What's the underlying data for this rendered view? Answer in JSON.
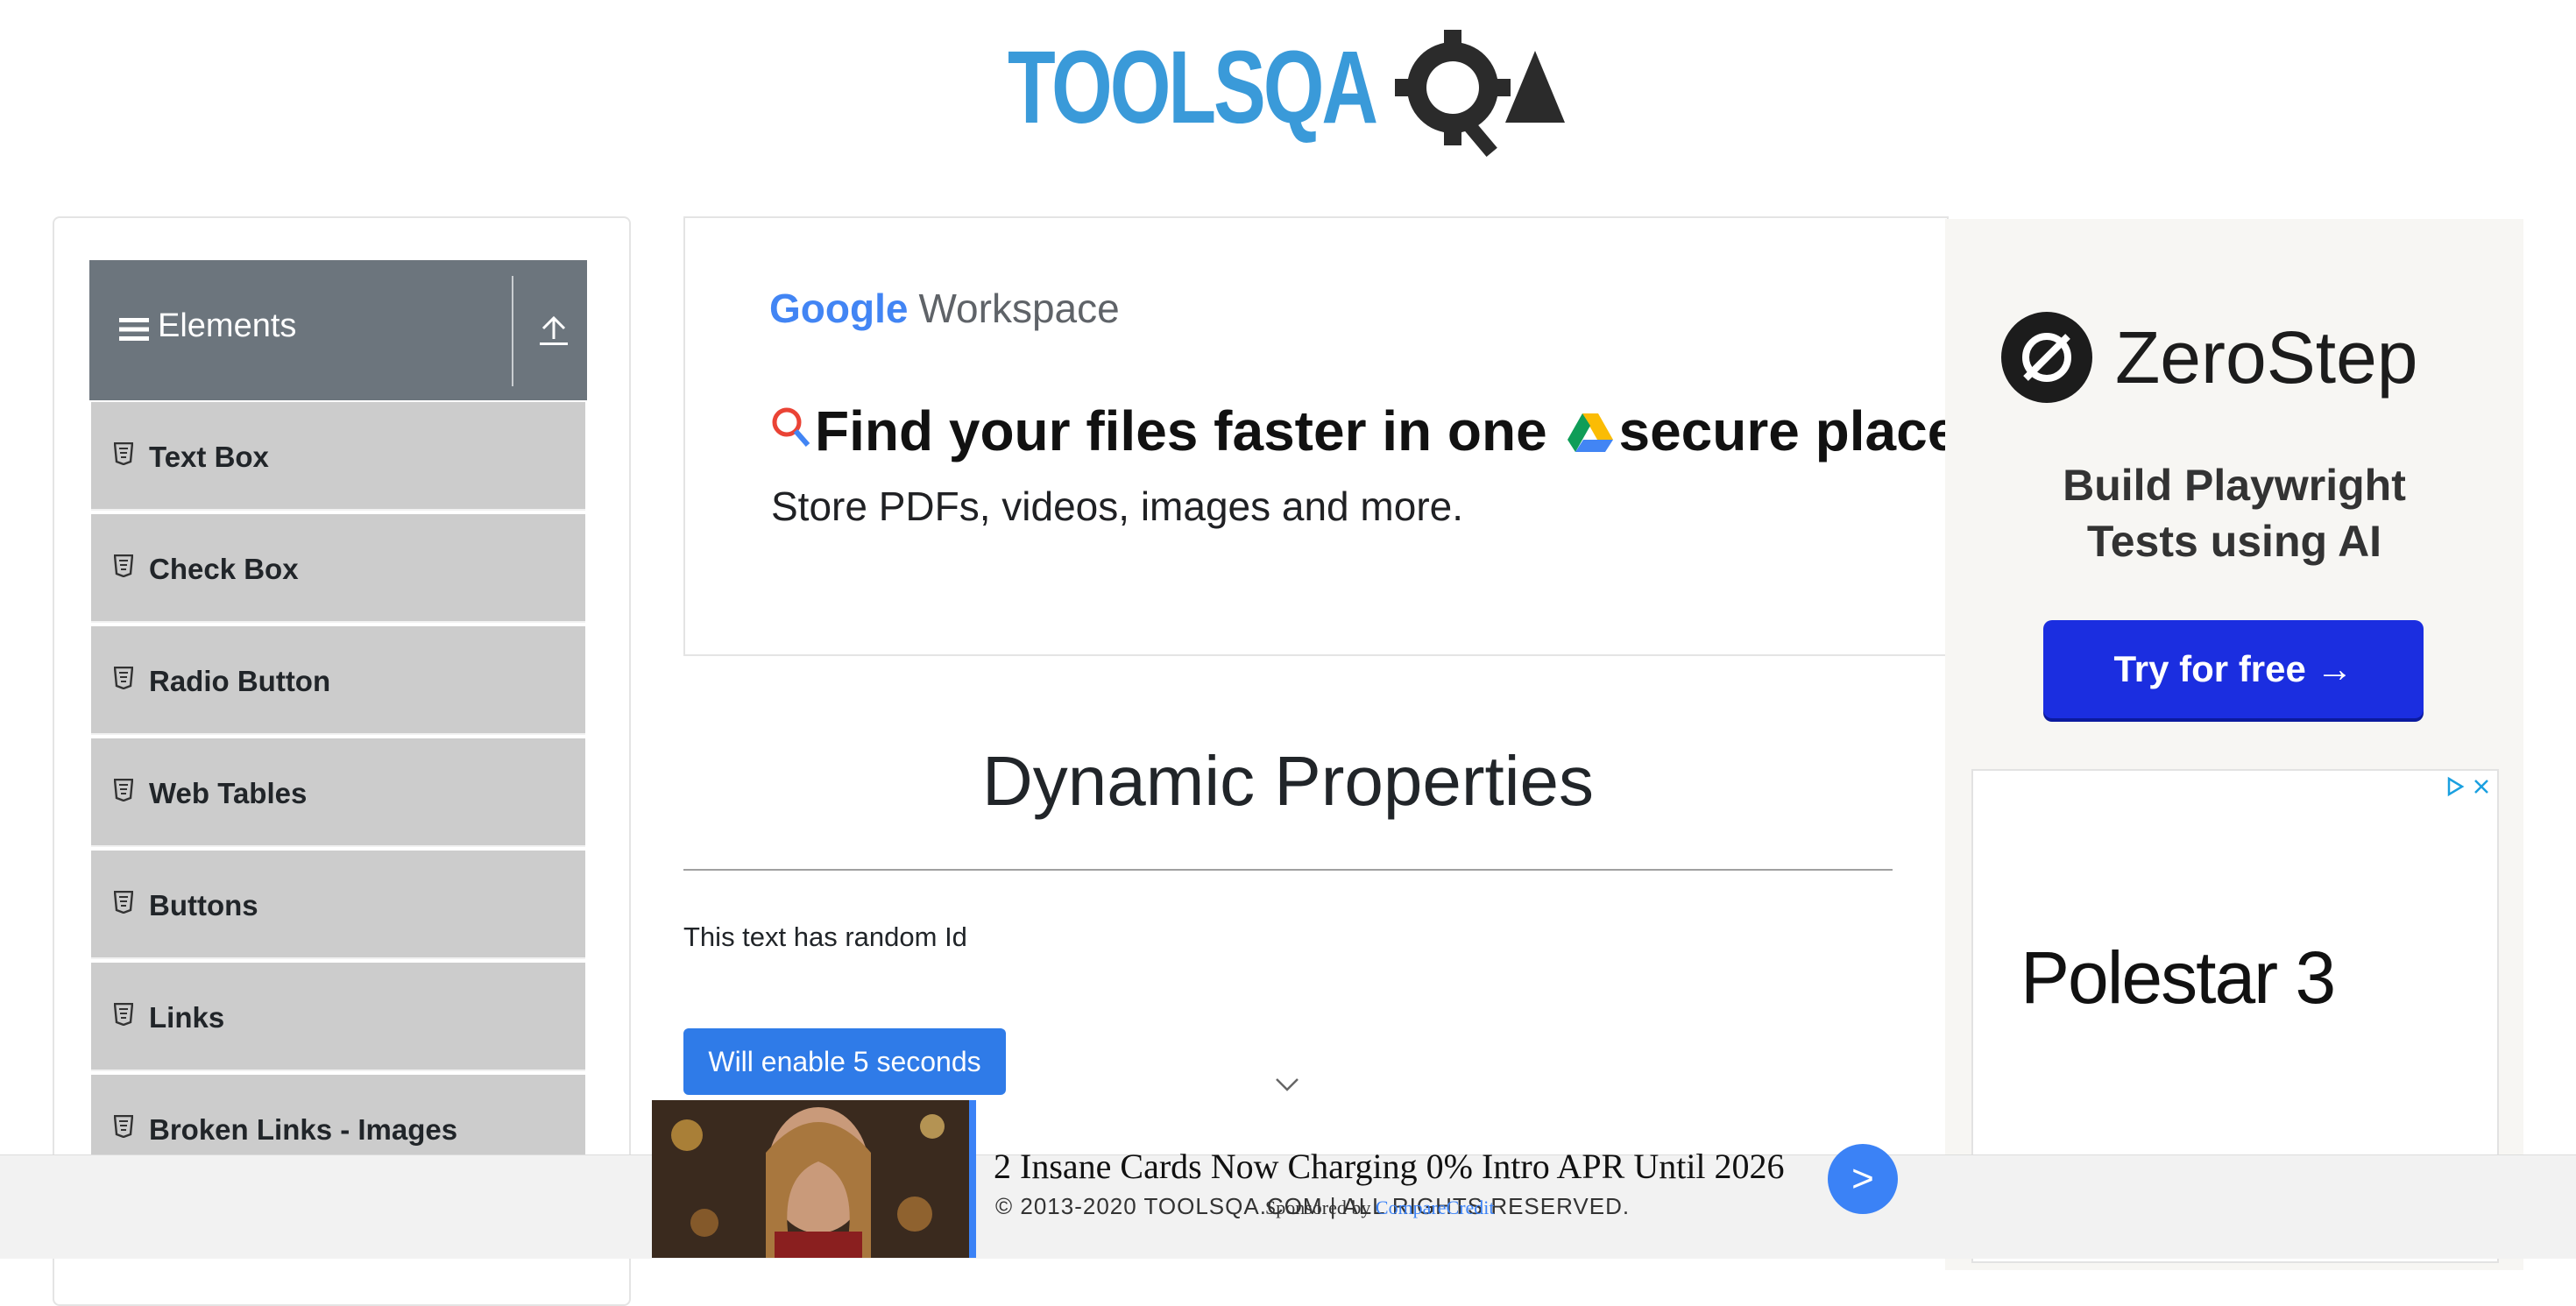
{
  "header": {
    "logo_text": "TOOLSQA"
  },
  "sidebar": {
    "group_title": "Elements",
    "items": [
      {
        "label": "Text Box"
      },
      {
        "label": "Check Box"
      },
      {
        "label": "Radio Button"
      },
      {
        "label": "Web Tables"
      },
      {
        "label": "Buttons"
      },
      {
        "label": "Links"
      },
      {
        "label": "Broken Links - Images"
      }
    ]
  },
  "ad_workspace": {
    "brand": "Google",
    "product": "Workspace",
    "headline_part1": "Find your files faster in one",
    "headline_part2": "secure place.",
    "subline": "Store PDFs, videos, images and more."
  },
  "main": {
    "title": "Dynamic Properties",
    "random_id_text": "This text has random Id",
    "enable_button_label": "Will enable 5 seconds"
  },
  "ad_zerostep": {
    "brand": "ZeroStep",
    "tagline_line1": "Build Playwright",
    "tagline_line2": "Tests using AI",
    "cta_label": "Try for free →"
  },
  "ad_polestar": {
    "brand": "Polestar 3"
  },
  "footer": {
    "copyright": "© 2013-2020 TOOLSQA.COM | ALL RIGHTS RESERVED."
  },
  "bottom_ad": {
    "title": "2 Insane Cards Now Charging 0% Intro APR Until 2026",
    "sponsored_prefix": "Sponsored by",
    "sponsor_name": "CompareCredit",
    "cta_symbol": ">"
  },
  "colors": {
    "toolsqa_blue": "#3a9ad9",
    "sidebar_header": "#6c757d",
    "sidebar_item": "#cccccc",
    "primary_button": "#2f7be8",
    "zerostep_cta": "#1b2ee0",
    "ad_accent": "#3b82f6"
  }
}
